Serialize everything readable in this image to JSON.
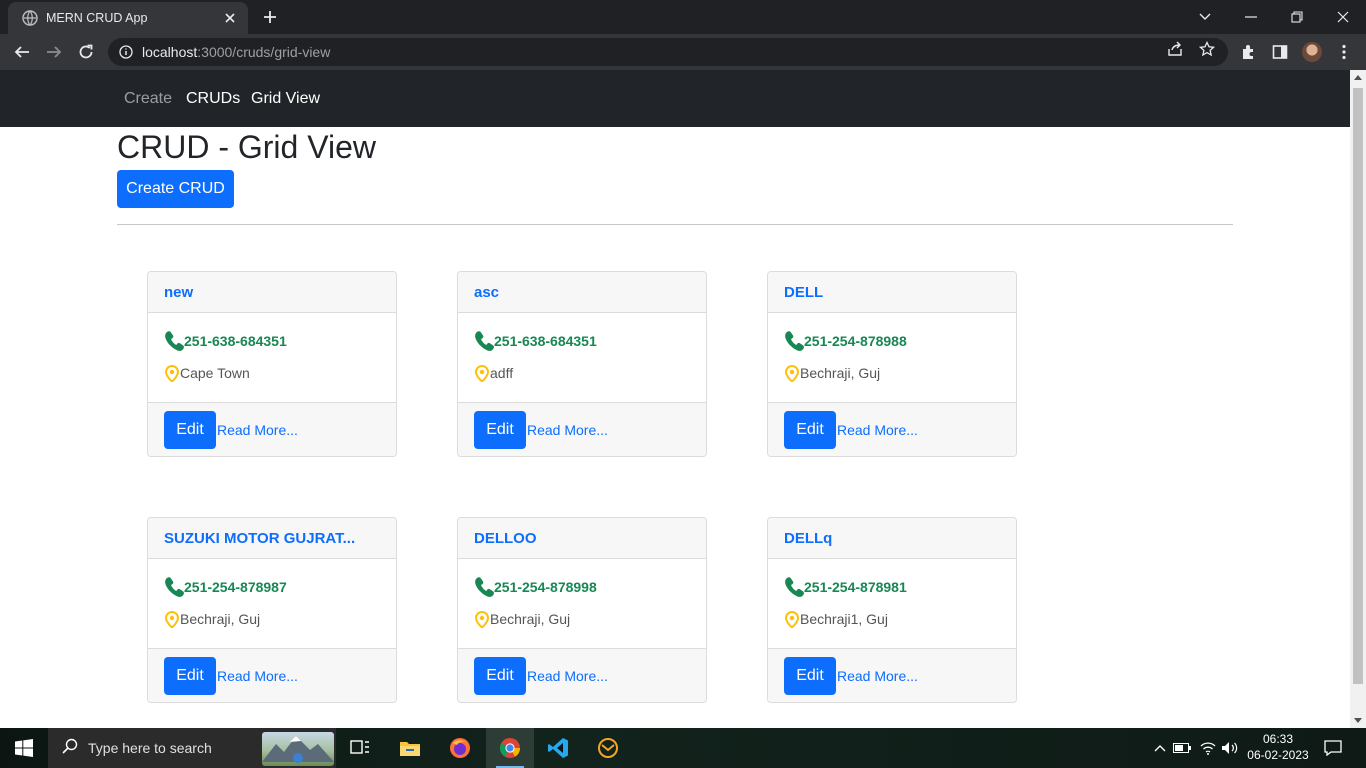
{
  "browser": {
    "tab_title": "MERN CRUD App",
    "url_host": "localhost",
    "url_rest": ":3000/cruds/grid-view"
  },
  "navbar": {
    "links": [
      {
        "label": "Create"
      },
      {
        "label": "CRUDs"
      },
      {
        "label": "Grid View"
      }
    ]
  },
  "page": {
    "title": "CRUD - Grid View",
    "create_button": "Create CRUD"
  },
  "cards": [
    {
      "title": "new",
      "phone": "251-638-684351",
      "location": "Cape Town",
      "edit_label": "Edit",
      "read_more": "Read More..."
    },
    {
      "title": "asc",
      "phone": "251-638-684351",
      "location": "adff",
      "edit_label": "Edit",
      "read_more": "Read More..."
    },
    {
      "title": "DELL",
      "phone": "251-254-878988",
      "location": "Bechraji, Guj",
      "edit_label": "Edit",
      "read_more": "Read More..."
    },
    {
      "title": "SUZUKI MOTOR GUJRAT...",
      "phone": "251-254-878987",
      "location": "Bechraji, Guj",
      "edit_label": "Edit",
      "read_more": "Read More..."
    },
    {
      "title": "DELLOO",
      "phone": "251-254-878998",
      "location": "Bechraji, Guj",
      "edit_label": "Edit",
      "read_more": "Read More..."
    },
    {
      "title": "DELLq",
      "phone": "251-254-878981",
      "location": "Bechraji1, Guj",
      "edit_label": "Edit",
      "read_more": "Read More..."
    }
  ],
  "taskbar": {
    "search_placeholder": "Type here to search",
    "time": "06:33",
    "date": "06-02-2023"
  },
  "colors": {
    "primary": "#0d6efd",
    "phone": "#198754",
    "location_icon": "#ffc107",
    "navbar": "#212529"
  }
}
